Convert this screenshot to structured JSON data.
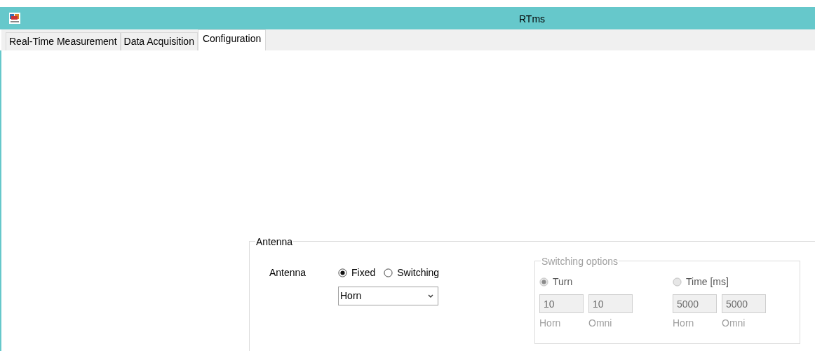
{
  "window": {
    "title": "RTms"
  },
  "tabs": [
    {
      "label": "Real-Time Measurement",
      "selected": false
    },
    {
      "label": "Data Acquisition",
      "selected": false
    },
    {
      "label": "Configuration",
      "selected": true
    }
  ],
  "antenna_group": {
    "title": "Antenna",
    "label": "Antenna",
    "modes": [
      {
        "label": "Fixed",
        "selected": true
      },
      {
        "label": "Switching",
        "selected": false
      }
    ],
    "dropdown": {
      "value": "Horn"
    },
    "switching_options": {
      "title": "Switching options",
      "disabled": true,
      "columns": [
        {
          "label": "Turn",
          "selected": true,
          "fields": [
            {
              "value": "10",
              "caption": "Horn"
            },
            {
              "value": "10",
              "caption": "Omni"
            }
          ]
        },
        {
          "label": "Time [ms]",
          "selected": false,
          "fields": [
            {
              "value": "5000",
              "caption": "Horn"
            },
            {
              "value": "5000",
              "caption": "Omni"
            }
          ]
        }
      ]
    }
  }
}
